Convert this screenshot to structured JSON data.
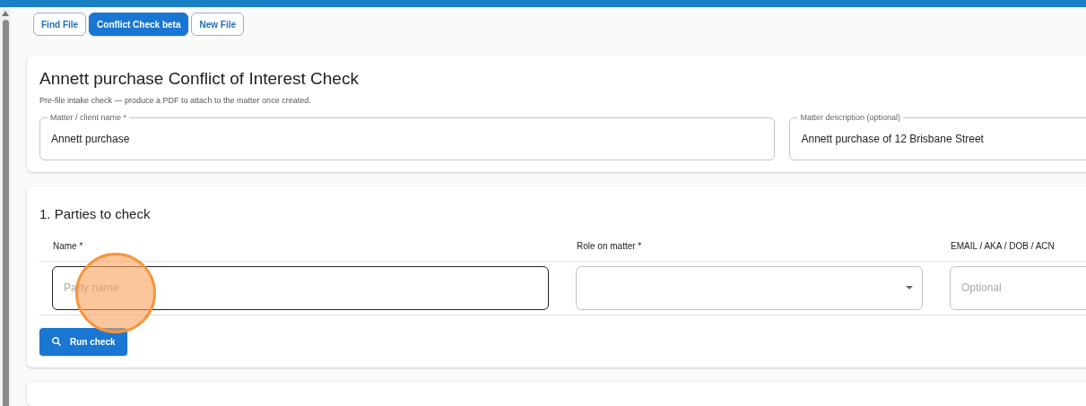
{
  "tabs": [
    {
      "label": "Find File",
      "selected": false
    },
    {
      "label": "Conflict Check beta",
      "selected": true
    },
    {
      "label": "New File",
      "selected": false
    }
  ],
  "intake": {
    "title": "Annett purchase Conflict of Interest Check",
    "subtitle": "Pre-file intake check — produce a PDF to attach to the matter once created.",
    "fields": [
      {
        "label": "Matter / client name *",
        "value": "Annett purchase"
      },
      {
        "label": "Matter description (optional)",
        "value": "Annett purchase of 12 Brisbane Street"
      }
    ]
  },
  "parties": {
    "heading": "1. Parties to check",
    "columns": [
      "Name *",
      "Role on matter *",
      "EMAIL / AKA / DOB / ACN"
    ],
    "row": [
      {
        "kind": "text",
        "placeholder": "Party name",
        "focused": true
      },
      {
        "kind": "select",
        "focused": false
      },
      {
        "kind": "text",
        "placeholder": "Optional",
        "focused": false
      }
    ],
    "button": "Run check"
  }
}
